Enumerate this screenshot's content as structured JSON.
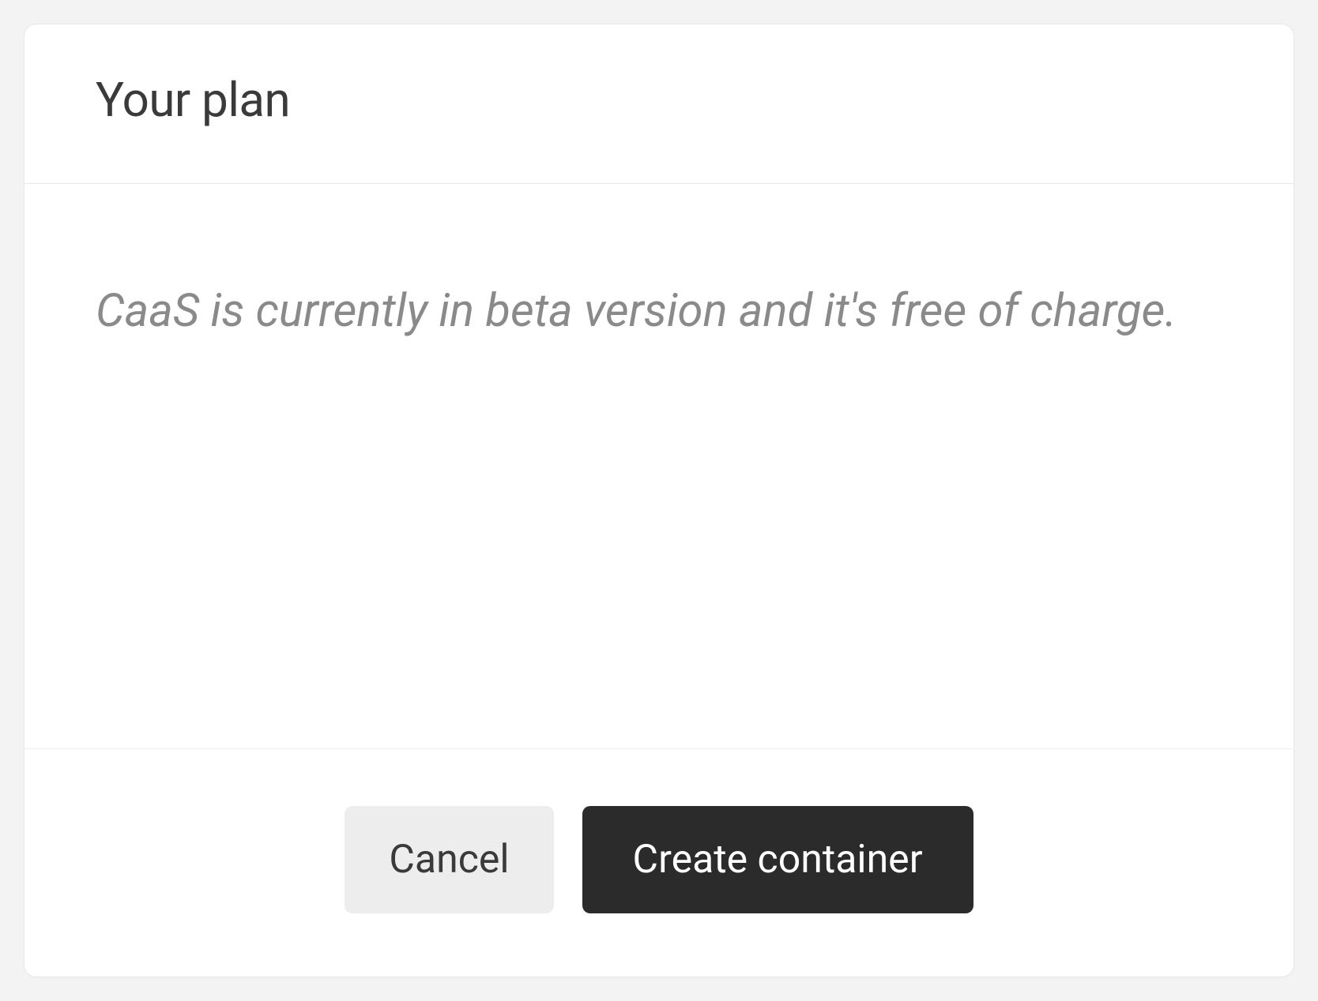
{
  "card": {
    "title": "Your plan",
    "description": "CaaS is currently in beta version and it's free of charge.",
    "actions": {
      "cancel": "Cancel",
      "create": "Create container"
    }
  }
}
